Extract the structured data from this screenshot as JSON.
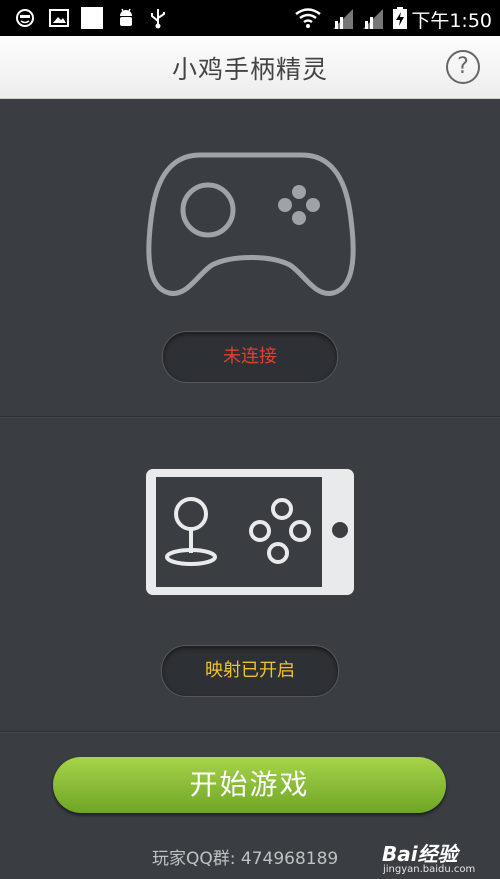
{
  "status_bar": {
    "time": "下午1:50",
    "icons": [
      "face-icon",
      "image-icon",
      "white-square-icon",
      "android-icon",
      "usb-icon",
      "wifi-icon",
      "signal-icon",
      "signal-icon",
      "battery-charging-icon"
    ]
  },
  "header": {
    "title": "小鸡手柄精灵",
    "help_label": "?"
  },
  "gamepad_section": {
    "icon": "gamepad-icon",
    "status": "未连接",
    "status_color": "#e0402f"
  },
  "phone_section": {
    "icon": "phone-controller-icon",
    "status": "映射已开启",
    "status_color": "#f0c22e"
  },
  "start_button": {
    "label": "开始游戏",
    "color": "#8dc038"
  },
  "footer": {
    "qq_group": "玩家QQ群: 474968189"
  },
  "watermark": {
    "brand": "Bai经验",
    "url": "jingyan.baidu.com"
  }
}
